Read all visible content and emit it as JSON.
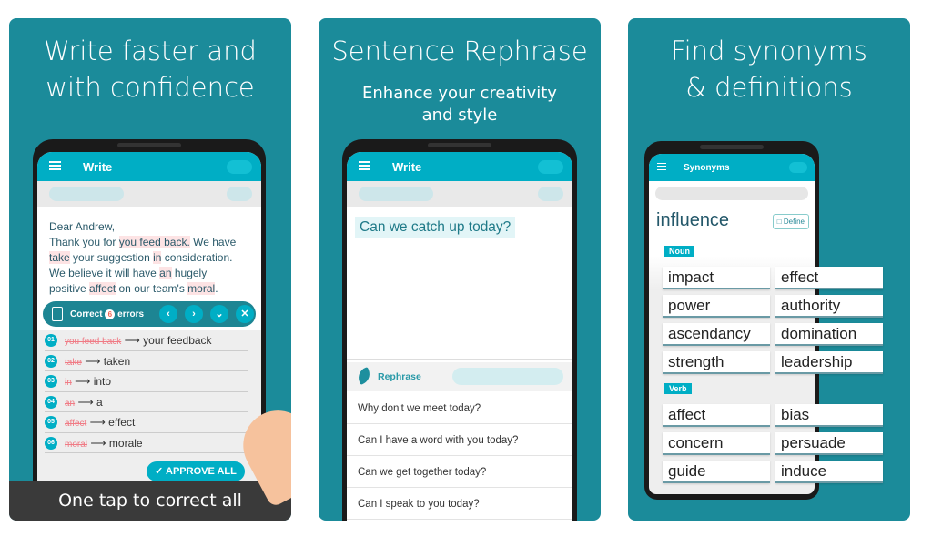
{
  "colors": {
    "panel": "#1b8b9a",
    "accent": "#00aec5",
    "error": "#f07b85"
  },
  "panel1": {
    "title_line1": "Write faster and",
    "title_line2": "with confidence",
    "app_title": "Write",
    "letter": {
      "l1": "Dear Andrew,",
      "l2a": "Thank you for ",
      "l2b": "you feed back.",
      "l2c": " We have",
      "l3a": "take",
      "l3b": " your suggestion ",
      "l3c": "in",
      "l3d": " consideration.",
      "l4a": "We believe it will have ",
      "l4b": "an",
      "l4c": " hugely",
      "l5a": "positive ",
      "l5b": "affect",
      "l5c": " on our team's ",
      "l5d": "moral",
      "l5e": "."
    },
    "correct_label": "Correct",
    "error_count": "6",
    "errors_label": "errors",
    "corrections": [
      {
        "n": "01",
        "wrong": "you feed back",
        "right": "your feedback"
      },
      {
        "n": "02",
        "wrong": "take",
        "right": "taken"
      },
      {
        "n": "03",
        "wrong": "in",
        "right": "into"
      },
      {
        "n": "04",
        "wrong": "an",
        "right": "a"
      },
      {
        "n": "05",
        "wrong": "affect",
        "right": "effect"
      },
      {
        "n": "06",
        "wrong": "moral",
        "right": "morale"
      }
    ],
    "approve_label": "APPROVE ALL",
    "caption": "One tap to correct all"
  },
  "panel2": {
    "title": "Sentence Rephrase",
    "subtitle_line1": "Enhance your creativity",
    "subtitle_line2": "and style",
    "app_title": "Write",
    "input_text": "Can we catch up today?",
    "rephrase_label": "Rephrase",
    "suggestions": [
      "Why don't we meet today?",
      "Can I have a word with you today?",
      "Can we get together today?",
      "Can I speak to you today?"
    ]
  },
  "panel3": {
    "title_line1": "Find synonyms",
    "title_line2": "& definitions",
    "app_title": "Synonyms",
    "word": "influence",
    "define_label": "Define",
    "noun_label": "Noun",
    "nouns": [
      "impact",
      "effect",
      "power",
      "authority",
      "ascendancy",
      "domination",
      "strength",
      "leadership"
    ],
    "verb_label": "Verb",
    "verbs": [
      "affect",
      "bias",
      "concern",
      "persuade",
      "guide",
      "induce"
    ]
  }
}
